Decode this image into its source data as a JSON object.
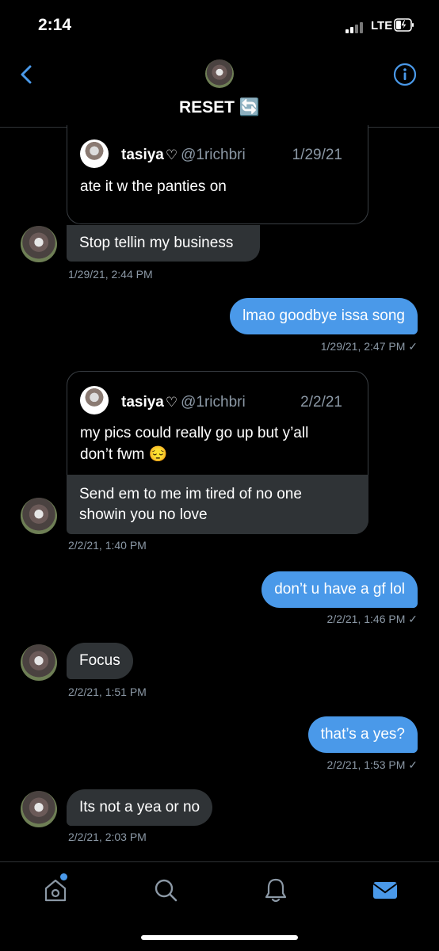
{
  "status_bar": {
    "time": "2:14",
    "network": "LTE"
  },
  "header": {
    "title": "RESET 🔄"
  },
  "messages": [
    {
      "quoted": {
        "name": "tasiya",
        "handle": "@1richbri",
        "date": "1/29/21",
        "text": "ate it w the panties on"
      },
      "text": "Stop tellin my business",
      "timestamp": "1/29/21, 2:44 PM"
    },
    {
      "text": "lmao goodbye issa song",
      "timestamp": "1/29/21, 2:47 PM ✓"
    },
    {
      "quoted": {
        "name": "tasiya",
        "handle": "@1richbri",
        "date": "2/2/21",
        "text_line1": "my pics could really go up but y’all",
        "text_line2": "don’t fwm 😔"
      },
      "text_line1": "Send em to me im tired of no one",
      "text_line2": "showin you no love",
      "timestamp": "2/2/21, 1:40 PM"
    },
    {
      "text": "don’t u have a gf lol",
      "timestamp": "2/2/21, 1:46 PM ✓"
    },
    {
      "text": "Focus",
      "timestamp": "2/2/21, 1:51 PM"
    },
    {
      "text": "that’s a yes?",
      "timestamp": "2/2/21, 1:53 PM ✓"
    },
    {
      "text": "Its not a yea or no",
      "timestamp": "2/2/21, 2:03 PM"
    }
  ],
  "tab_bar": {
    "items": [
      "home-icon",
      "search-icon",
      "notifications-icon",
      "messages-icon"
    ],
    "active": "messages-icon",
    "accent": "#4a99e9"
  },
  "colors": {
    "outgoing_bubble": "#4a99e9",
    "incoming_bubble": "#2f3336",
    "muted_text": "#8b98a5"
  }
}
